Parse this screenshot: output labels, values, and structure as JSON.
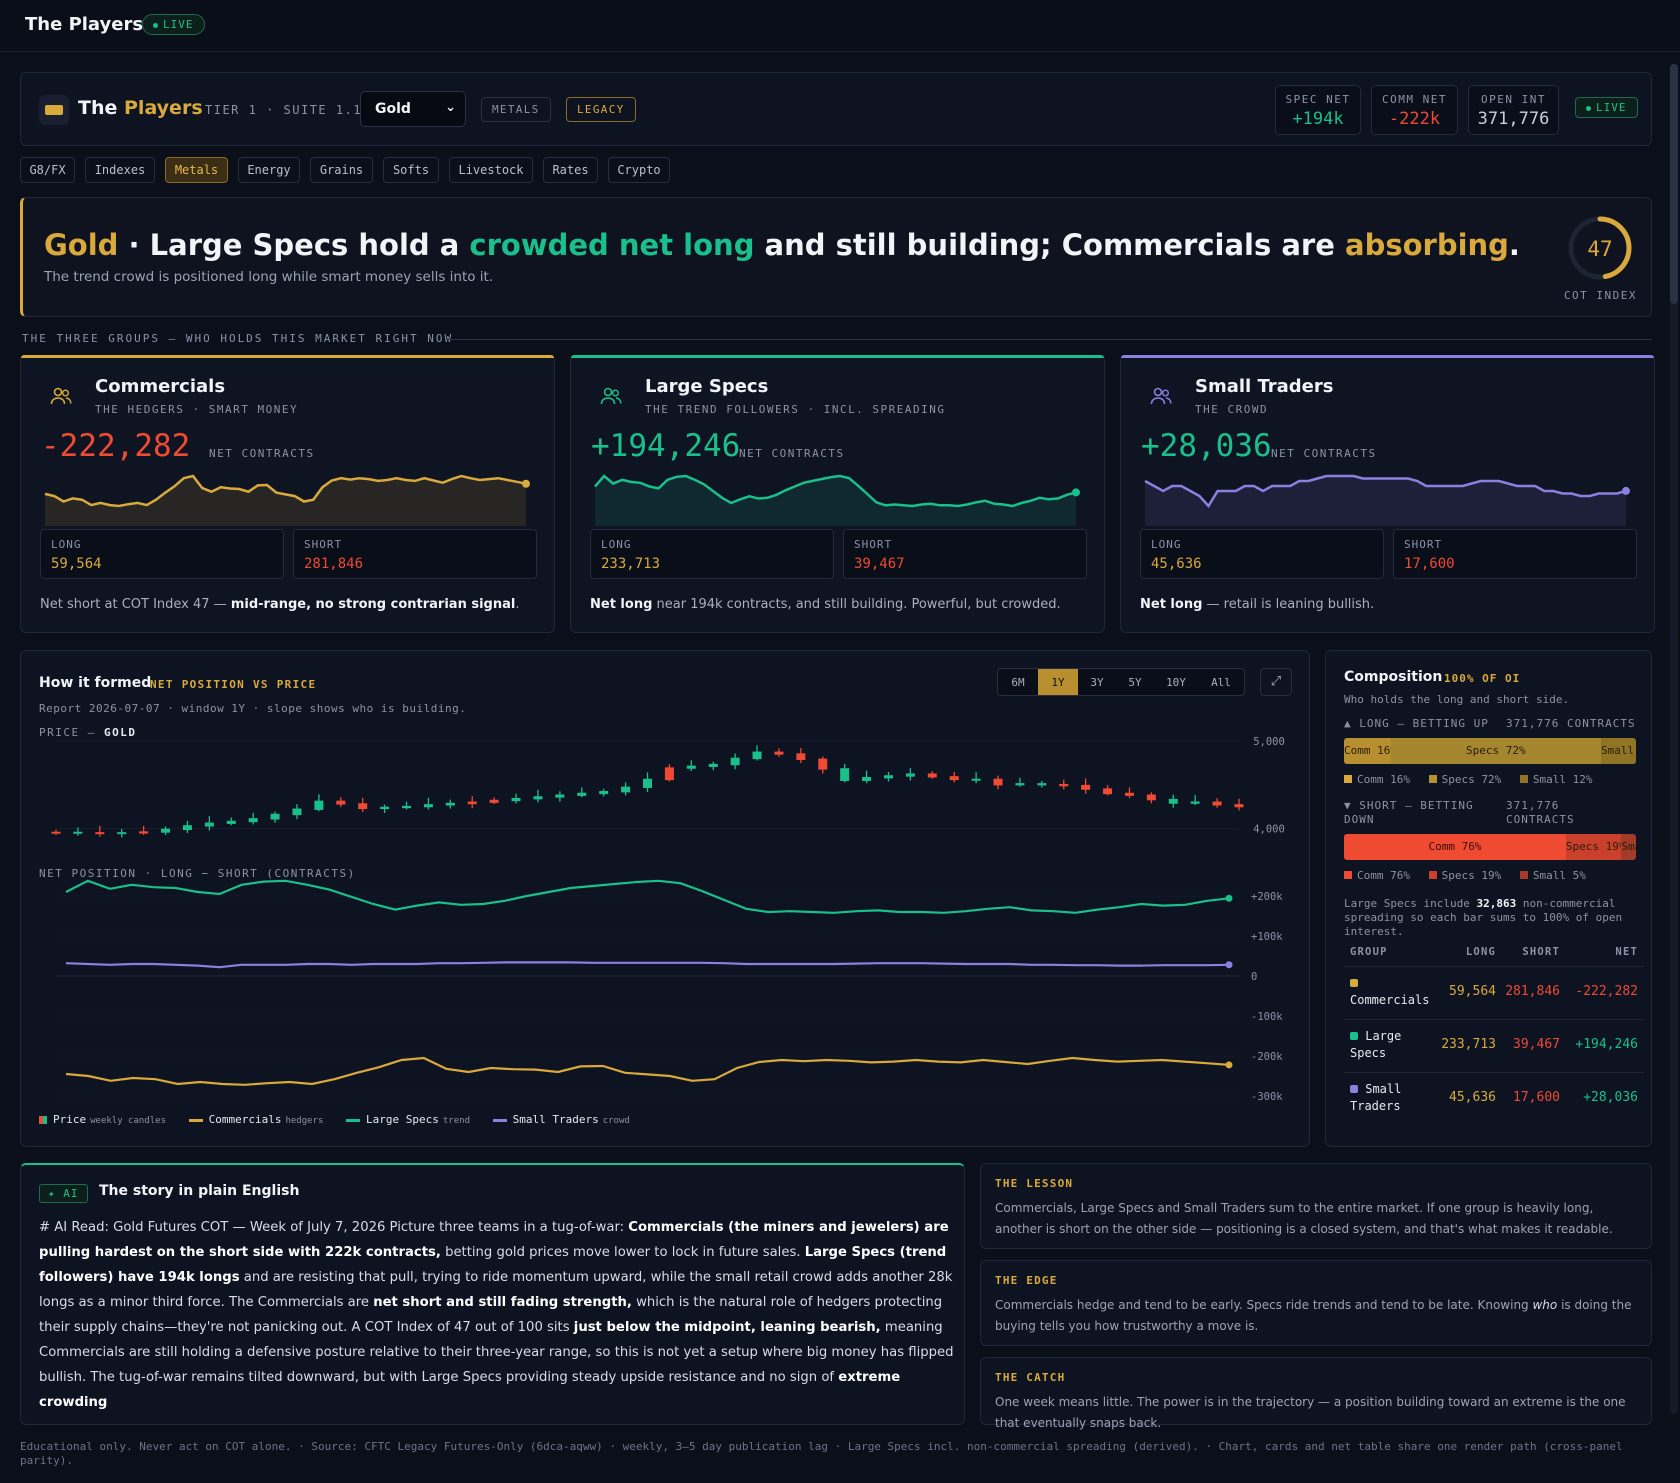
{
  "app": {
    "title": "The Players",
    "live": "LIVE"
  },
  "header": {
    "title_a": "The",
    "title_b": "Players",
    "tier": "TIER 1 · SUITE 1.1",
    "market": "Gold",
    "tag1": "METALS",
    "tag2": "LEGACY",
    "stats": [
      {
        "label": "SPEC NET",
        "value": "+194k"
      },
      {
        "label": "COMM NET",
        "value": "-222k"
      },
      {
        "label": "OPEN INT",
        "value": "371,776"
      }
    ],
    "live": "LIVE"
  },
  "tabs": [
    "G8/FX",
    "Indexes",
    "Metals",
    "Energy",
    "Grains",
    "Softs",
    "Livestock",
    "Rates",
    "Crypto"
  ],
  "hero": {
    "market": "Gold",
    "dot": " · ",
    "p1": "Large Specs hold a ",
    "p2": "crowded net long",
    "p3": " and still building; Commercials are ",
    "p4": "absorbing",
    "p5": ".",
    "sub": "The trend crowd is positioned long while smart money sells into it.",
    "cot_index": "47",
    "cot_label": "COT INDEX",
    "cot_fraction": 0.47
  },
  "section_label": "THE THREE GROUPS — WHO HOLDS THIS MARKET RIGHT NOW",
  "cards": [
    {
      "name": "Commercials",
      "sub": "THE HEDGERS · SMART MONEY",
      "net": "-222,282",
      "unit": "NET CONTRACTS",
      "long_label": "LONG",
      "long": "59,564",
      "short_label": "SHORT",
      "short": "281,846",
      "note_a": "Net short at COT Index 47 — ",
      "note_b": "mid-range, no strong contrarian signal",
      "note_c": "."
    },
    {
      "name": "Large Specs",
      "sub": "THE TREND FOLLOWERS · INCL. SPREADING",
      "net": "+194,246",
      "unit": "NET CONTRACTS",
      "long_label": "LONG",
      "long": "233,713",
      "short_label": "SHORT",
      "short": "39,467",
      "note_a": "",
      "note_b": "Net long",
      "note_c": " near 194k contracts, and still building. Powerful, but crowded."
    },
    {
      "name": "Small Traders",
      "sub": "THE CROWD",
      "net": "+28,036",
      "unit": "NET CONTRACTS",
      "long_label": "LONG",
      "long": "45,636",
      "short_label": "SHORT",
      "short": "17,600",
      "note_a": "",
      "note_b": "Net long",
      "note_c": " — retail is leaning bullish."
    }
  ],
  "chart": {
    "title": "How it formed",
    "tag": "NET POSITION VS PRICE",
    "meta": "Report 2026-07-07 · window 1Y · slope shows who is building.",
    "price_label": "PRICE — ",
    "price_market": "GOLD",
    "net_label": "NET POSITION · LONG − SHORT (CONTRACTS)",
    "ranges": [
      "6M",
      "1Y",
      "3Y",
      "5Y",
      "10Y",
      "All"
    ],
    "active_range": "1Y",
    "expand": "⤢",
    "legend": [
      {
        "name": "Price",
        "note": "weekly candles"
      },
      {
        "name": "Commercials",
        "note": "hedgers"
      },
      {
        "name": "Large Specs",
        "note": "trend"
      },
      {
        "name": "Small Traders",
        "note": "crowd"
      }
    ]
  },
  "chart_data": [
    {
      "type": "candlestick",
      "title": "PRICE — GOLD",
      "y_ticks": [
        "5,000",
        "4,000"
      ],
      "ylim": [
        3800,
        5250
      ],
      "close": [
        3955,
        3950,
        3950,
        3950,
        3960,
        3990,
        4030,
        4060,
        4080,
        4110,
        4160,
        4220,
        4310,
        4280,
        4230,
        4240,
        4250,
        4270,
        4285,
        4300,
        4320,
        4340,
        4360,
        4380,
        4400,
        4420,
        4470,
        4560,
        4690,
        4710,
        4730,
        4800,
        4870,
        4850,
        4790,
        4680,
        4550,
        4580,
        4600,
        4620,
        4590,
        4560,
        4560,
        4500,
        4510,
        4500,
        4490,
        4450,
        4400,
        4380,
        4330,
        4290,
        4300,
        4270,
        4250
      ],
      "bull": [
        false,
        true,
        false,
        true,
        false,
        true,
        true,
        true,
        true,
        true,
        true,
        true,
        true,
        false,
        false,
        true,
        true,
        true,
        true,
        false,
        false,
        true,
        true,
        true,
        true,
        true,
        true,
        true,
        false,
        true,
        true,
        true,
        true,
        false,
        false,
        false,
        true,
        true,
        true,
        true,
        false,
        false,
        true,
        false,
        true,
        true,
        false,
        false,
        false,
        false,
        false,
        true,
        true,
        false,
        false
      ]
    },
    {
      "type": "line",
      "title": "NET POSITION · LONG − SHORT (CONTRACTS)",
      "y_ticks": [
        "+200k",
        "+100k",
        "0",
        "-100k",
        "-200k",
        "-300k"
      ],
      "ylim": [
        -300000,
        200000
      ],
      "series": [
        {
          "name": "Commercials",
          "values": [
            -245000,
            -250000,
            -262000,
            -255000,
            -258000,
            -270000,
            -265000,
            -270000,
            -272000,
            -268000,
            -265000,
            -270000,
            -258000,
            -242000,
            -228000,
            -210000,
            -205000,
            -232000,
            -240000,
            -230000,
            -233000,
            -234000,
            -240000,
            -226000,
            -225000,
            -242000,
            -246000,
            -250000,
            -262000,
            -258000,
            -230000,
            -215000,
            -210000,
            -213000,
            -210000,
            -212000,
            -216000,
            -214000,
            -210000,
            -214000,
            -216000,
            -210000,
            -215000,
            -220000,
            -212000,
            -205000,
            -210000,
            -214000,
            -212000,
            -210000,
            -214000,
            -218000,
            -222282
          ]
        },
        {
          "name": "Large Specs",
          "values": [
            210000,
            238000,
            218000,
            228000,
            222000,
            220000,
            210000,
            205000,
            228000,
            236000,
            238000,
            228000,
            216000,
            198000,
            180000,
            166000,
            176000,
            184000,
            178000,
            180000,
            188000,
            200000,
            210000,
            220000,
            225000,
            230000,
            235000,
            238000,
            232000,
            212000,
            190000,
            168000,
            160000,
            162000,
            160000,
            158000,
            162000,
            164000,
            160000,
            160000,
            158000,
            162000,
            168000,
            172000,
            164000,
            162000,
            158000,
            166000,
            172000,
            180000,
            176000,
            178000,
            188000,
            194246
          ]
        },
        {
          "name": "Small Traders",
          "values": [
            32000,
            30000,
            28000,
            30000,
            30000,
            28000,
            26000,
            22000,
            28000,
            28000,
            28000,
            30000,
            30000,
            28000,
            30000,
            30000,
            30000,
            32000,
            32000,
            33000,
            34000,
            34000,
            34000,
            34000,
            33000,
            33000,
            33000,
            33000,
            33000,
            33000,
            32000,
            30000,
            30000,
            30000,
            30000,
            30000,
            31000,
            32000,
            32000,
            32000,
            31000,
            30000,
            30000,
            30000,
            28000,
            28000,
            27000,
            27000,
            26000,
            26000,
            27000,
            27000,
            27000,
            28036
          ]
        }
      ]
    }
  ],
  "composition": {
    "title": "Composition",
    "tag": "100% OF OI",
    "sub": "Who holds the long and short side.",
    "long_label": "▲ LONG — BETTING UP",
    "long_total": "371,776 CONTRACTS",
    "long_segments": [
      {
        "label": "Comm 16%",
        "pct": 16,
        "color": "#b88f2e"
      },
      {
        "label": "Specs 72%",
        "pct": 72,
        "color": "#a3862e"
      },
      {
        "label": "Small 12%",
        "pct": 12,
        "color": "#8f7426"
      }
    ],
    "long_key": [
      "Comm 16%",
      "Specs 72%",
      "Small 12%"
    ],
    "short_label": "▼ SHORT — BETTING DOWN",
    "short_total": "371,776 CONTRACTS",
    "short_segments": [
      {
        "label": "Comm 76%",
        "pct": 76,
        "color": "#ef4a32"
      },
      {
        "label": "Specs 19%",
        "pct": 19,
        "color": "#c9402c"
      },
      {
        "label": "Small 5%",
        "pct": 5,
        "color": "#a33a2a"
      }
    ],
    "short_key": [
      "Comm 76%",
      "Specs 19%",
      "Small 5%"
    ],
    "note_a": "Large Specs include ",
    "note_b": "32,863",
    "note_c": " non-commercial spreading so each bar sums to 100% of open interest.",
    "table_head": [
      "GROUP",
      "LONG",
      "SHORT",
      "NET"
    ],
    "rows": [
      {
        "group": "Commercials",
        "long": "59,564",
        "short": "281,846",
        "net": "-222,282"
      },
      {
        "group": "Large Specs",
        "long": "233,713",
        "short": "39,467",
        "net": "+194,246"
      },
      {
        "group": "Small Traders",
        "long": "45,636",
        "short": "17,600",
        "net": "+28,036"
      }
    ]
  },
  "story": {
    "badge": "✦ AI",
    "title": "The story in plain English",
    "parts": [
      {
        "t": "# AI Read: Gold Futures COT — Week of July 7, 2026 Picture three teams in a tug-of-war: ",
        "b": false
      },
      {
        "t": "Commercials (the miners and jewelers) are pulling hardest on the short side with 222k contracts,",
        "b": true
      },
      {
        "t": " betting gold prices move lower to lock in future sales. ",
        "b": false
      },
      {
        "t": "Large Specs (trend followers) have 194k longs",
        "b": true
      },
      {
        "t": " and are resisting that pull, trying to ride momentum upward, while the small retail crowd adds another 28k longs as a minor third force. The Commercials are ",
        "b": false
      },
      {
        "t": "net short and still fading strength,",
        "b": true
      },
      {
        "t": " which is the natural role of hedgers protecting their supply chains—they're not panicking out. A COT Index of 47 out of 100 sits ",
        "b": false
      },
      {
        "t": "just below the midpoint, leaning bearish,",
        "b": true
      },
      {
        "t": " meaning Commercials are still holding a defensive posture relative to their three-year range, so this is not yet a setup where big money has flipped bullish. The tug-of-war remains tilted downward, but with Large Specs providing steady upside resistance and no sign of ",
        "b": false
      },
      {
        "t": "extreme crowding",
        "b": true
      }
    ]
  },
  "side": [
    {
      "k": "THE LESSON",
      "v": "Commercials, Large Specs and Small Traders sum to the entire market. If one group is heavily long, another is short on the other side — positioning is a closed system, and that's what makes it readable."
    },
    {
      "k": "THE EDGE",
      "v_a": "Commercials hedge and tend to be early. Specs ride trends and tend to be late. Knowing ",
      "v_em": "who",
      "v_b": " is doing the buying tells you how trustworthy a move is."
    },
    {
      "k": "THE CATCH",
      "v": "One week means little. The power is in the trajectory — a position building toward an extreme is the one that eventually snaps back."
    }
  ],
  "footer": "Educational only. Never act on COT alone. · Source: CFTC Legacy Futures-Only (6dca-aqww) · weekly, 3–5 day publication lag · Large Specs incl. non-commercial spreading (derived). · Chart, cards and net table share one render path (cross-panel parity).",
  "colors": {
    "gold": "#d9a93b",
    "green": "#19c08c",
    "red": "#ef4a32",
    "purple": "#8b7fe0"
  }
}
